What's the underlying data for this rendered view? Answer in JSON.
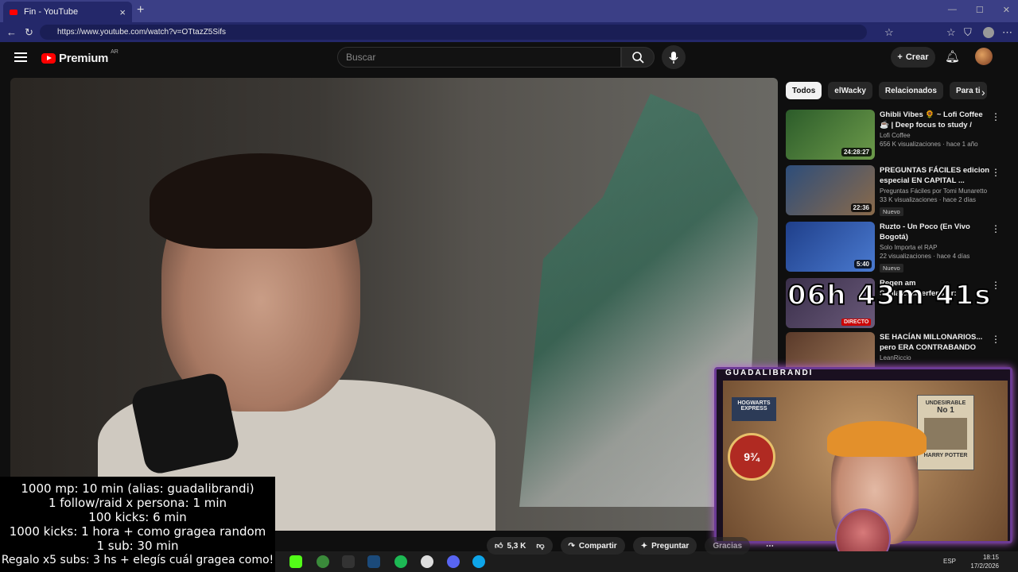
{
  "browser": {
    "tab_title": "Fin - YouTube",
    "url": "https://www.youtube.com/watch?v=OTtazZ5Sifs"
  },
  "youtube": {
    "logo_text": "Premium",
    "logo_region": "AR",
    "search_placeholder": "Buscar",
    "create_label": "Crear"
  },
  "video": {
    "overlay_timer": "06h 43m 41s",
    "likes": "5,3 K",
    "share_label": "Compartir",
    "ask_label": "Preguntar",
    "thanks_label": "Gracias"
  },
  "chips": [
    "Todos",
    "elWacky",
    "Relacionados",
    "Para ti"
  ],
  "recommendations": [
    {
      "title": "Ghibli Vibes 🌻 ~ Lofi Coffee ☕ | Deep focus to study / rela...",
      "channel": "Lofi Coffee",
      "meta": "656 K visualizaciones · hace 1 año",
      "duration": "24:28:27",
      "badge": "",
      "thumb_color": "#3f6b3a"
    },
    {
      "title": "PREGUNTAS FÁCILES edicion especial EN CAPITAL ...",
      "channel": "Preguntas Fáciles por Tomi Munaretto",
      "meta": "33 K visualizaciones · hace 2 días",
      "duration": "22:36",
      "badge": "Nuevo",
      "thumb_color": "#3a5a8a"
    },
    {
      "title": "Ruzto - Un Poco (En Vivo Bogotá)",
      "channel": "Solo Importa el RAP",
      "meta": "22 visualizaciones · hace 4 días",
      "duration": "5:40",
      "badge": "Nuevo",
      "thumb_color": "#2b4f9a"
    },
    {
      "title": "Regen am Schlafzimmerfenster:",
      "channel": "",
      "meta": "",
      "duration": "",
      "badge": "",
      "live": "DIRECTO",
      "thumb_color": "#4a3d5a"
    },
    {
      "title": "SE HACÍAN MILLONARIOS... pero ERA CONTRABANDO",
      "channel": "LeanRiccio",
      "meta": "",
      "duration": "",
      "badge": "",
      "thumb_color": "#7a4a3a"
    }
  ],
  "cam": {
    "label": "GUADALIBRANDI",
    "poster_wanted_1": "UNDESIRABLE",
    "poster_wanted_2": "No 1",
    "poster_wanted_3": "HARRY POTTER",
    "platform": "9¾",
    "express": "HOGWARTS EXPRESS"
  },
  "goals": [
    "1000 mp: 10 min (alias: guadalibrandi)",
    "1 follow/raid x persona: 1 min",
    "100 kicks: 6 min",
    "1000 kicks: 1 hora + como gragea random",
    "1 sub: 30 min",
    "Regalo x5 subs: 3 hs + elegís cuál gragea como!"
  ],
  "taskbar": {
    "lang": "ESP",
    "time": "18:15",
    "date": "17/2/2026"
  },
  "colors": {
    "youtube_red": "#ff0000",
    "browser_tab": "#3b3f86",
    "cam_border": "#6b3a94"
  }
}
